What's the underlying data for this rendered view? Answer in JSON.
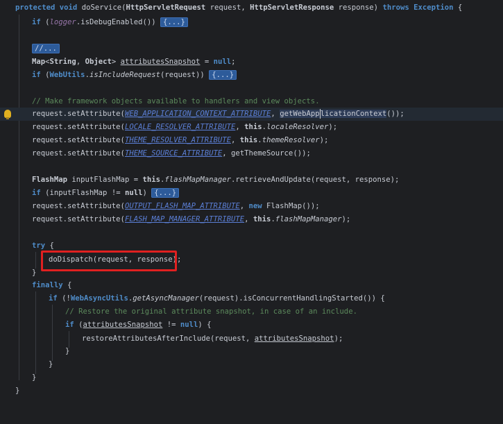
{
  "code": {
    "signature": {
      "protected": "protected",
      "void": "void",
      "method": "doService(",
      "req_type": "HttpServletRequest",
      "req": " request, ",
      "resp_type": "HttpServletResponse",
      "resp": " response) ",
      "throws": "throws",
      "exc": "Exception",
      "brace": " {"
    },
    "l2": {
      "if": "if",
      "open": " (",
      "logger": "logger",
      "call": ".isDebugEnabled()) ",
      "fold": "{...}"
    },
    "l4": {
      "fold": "//..."
    },
    "l5": {
      "map": "Map",
      "lt": "<",
      "string": "String",
      "comma": ", ",
      "object": "Object",
      "gt": "> ",
      "var": "attributesSnapshot",
      "eq": " = ",
      "null": "null",
      "semi": ";"
    },
    "l6": {
      "if": "if",
      "open": " (",
      "cls": "WebUtils",
      "dot": ".",
      "method": "isIncludeRequest",
      "args": "(request)) ",
      "fold": "{...}"
    },
    "l8": {
      "comment": "// Make framework objects available to handlers and view objects."
    },
    "l9": {
      "pre": "request.setAttribute(",
      "const": "WEB_APPLICATION_CONTEXT_ATTRIBUTE",
      "comma": ", ",
      "call_a": "getWebApp",
      "call_b": "licationContext",
      "post": "());"
    },
    "l10": {
      "pre": "request.setAttribute(",
      "const": "LOCALE_RESOLVER_ATTRIBUTE",
      "comma": ", ",
      "this": "this",
      "dot": ".",
      "field": "localeResolver",
      "post": ");"
    },
    "l11": {
      "pre": "request.setAttribute(",
      "const": "THEME_RESOLVER_ATTRIBUTE",
      "comma": ", ",
      "this": "this",
      "dot": ".",
      "field": "themeResolver",
      "post": ");"
    },
    "l12": {
      "pre": "request.setAttribute(",
      "const": "THEME_SOURCE_ATTRIBUTE",
      "post": ", getThemeSource());"
    },
    "l14": {
      "type": "FlashMap",
      "mid": " inputFlashMap = ",
      "this": "this",
      "dot": ".",
      "field": "flashMapManager",
      "post": ".retrieveAndUpdate(request, response);"
    },
    "l15": {
      "if": "if",
      "mid": " (inputFlashMap != ",
      "null": "null",
      "close": ") ",
      "fold": "{...}"
    },
    "l16": {
      "pre": "request.setAttribute(",
      "const": "OUTPUT_FLASH_MAP_ATTRIBUTE",
      "comma": ", ",
      "new": "new",
      "post": " FlashMap());"
    },
    "l17": {
      "pre": "request.setAttribute(",
      "const": "FLASH_MAP_MANAGER_ATTRIBUTE",
      "comma": ", ",
      "this": "this",
      "dot": ".",
      "field": "flashMapManager",
      "post": ");"
    },
    "l19": {
      "try": "try",
      "brace": " {"
    },
    "l20": {
      "text": "doDispatch(request, response);"
    },
    "l21": {
      "text": "}"
    },
    "l22": {
      "finally": "finally",
      "brace": " {"
    },
    "l23": {
      "if": "if",
      "open": " (!",
      "cls": "WebAsyncUtils",
      "dot": ".",
      "method": "getAsyncManager",
      "post": "(request).isConcurrentHandlingStarted()) {"
    },
    "l24": {
      "comment": "// Restore the original attribute snapshot, in case of an include."
    },
    "l25": {
      "if": "if",
      "open": " (",
      "var": "attributesSnapshot",
      "mid": " != ",
      "null": "null",
      "close": ") {"
    },
    "l26": {
      "pre": "restoreAttributesAfterInclude(request, ",
      "var": "attributesSnapshot",
      "post": ");"
    },
    "l27": {
      "text": "}"
    },
    "l28": {
      "text": "}"
    },
    "l29": {
      "text": "}"
    },
    "l30": {
      "text": "}"
    }
  },
  "colors": {
    "background": "#1e1f22",
    "keyword": "#4f8cc9",
    "comment": "#5c8a5c",
    "constant": "#5b7fd6",
    "field": "#9876aa",
    "highlight_box": "#e02020",
    "bulb": "#e0b020"
  },
  "icons": {
    "intention": "lightbulb-icon"
  }
}
